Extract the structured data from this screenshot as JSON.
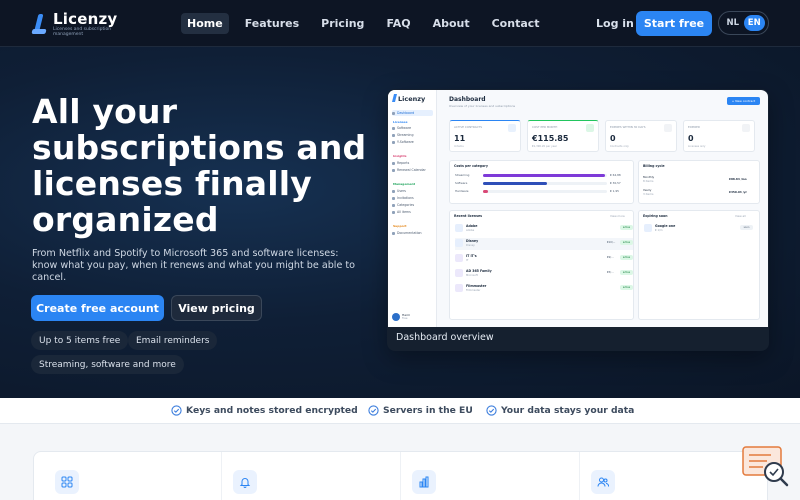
{
  "brand": {
    "name": "Licenzy",
    "tagline": "Licenses and subscription management"
  },
  "nav": {
    "items": [
      "Home",
      "Features",
      "Pricing",
      "FAQ",
      "About",
      "Contact"
    ],
    "active": "Home",
    "login": "Log in",
    "start": "Start free",
    "languages": [
      "NL",
      "EN"
    ],
    "active_language": "EN"
  },
  "hero": {
    "title": "All your subscriptions and licenses finally organized",
    "lead": "From Netflix and Spotify to Microsoft 365 and software licenses: know what you pay, when it renews and what you might be able to cancel.",
    "primary_cta": "Create free account",
    "secondary_cta": "View pricing",
    "chips": [
      "Up to 5 items free",
      "Email reminders",
      "Streaming, software and more"
    ]
  },
  "preview": {
    "caption": "Dashboard overview",
    "app_name": "Licenzy",
    "title": "Dashboard",
    "subtitle": "Overview of your licenses and subscriptions",
    "add_button": "+ New contract",
    "sidebar": {
      "items": [
        {
          "label": "Dashboard",
          "selected": true
        },
        {
          "label": "Licenses",
          "group": true
        },
        {
          "label": "Software"
        },
        {
          "label": "Streaming"
        },
        {
          "label": "Y-Software"
        },
        {
          "label": "Insights",
          "group": true
        },
        {
          "label": "Reports"
        },
        {
          "label": "Renewal Calendar"
        },
        {
          "label": "Management",
          "group": true
        },
        {
          "label": "Users"
        },
        {
          "label": "Invitations"
        },
        {
          "label": "Categories"
        },
        {
          "label": "All items"
        },
        {
          "label": "Support",
          "group": true
        },
        {
          "label": "Documentation"
        }
      ],
      "user_name": "Harm",
      "user_sub": "Free"
    },
    "kpis": [
      {
        "label": "ACTIVE CONTRACTS",
        "value": "11",
        "sub": "4 items"
      },
      {
        "label": "COST PER MONTH",
        "value": "€115.85",
        "sub": "€1,390.20 per year"
      },
      {
        "label": "EXPIRES WITHIN 30 DAYS",
        "value": "0",
        "sub": "Contracts only"
      },
      {
        "label": "EXPIRED",
        "value": "0",
        "sub": "Licenses only"
      }
    ],
    "cost_by_category": {
      "title": "Costs per category",
      "rows": [
        {
          "label": "Streaming",
          "value": "€ 62,88",
          "fraction": 0.98,
          "color": "#7e3ad8"
        },
        {
          "label": "Software",
          "value": "€ 30,57",
          "fraction": 0.52,
          "color": "#2f4fb8"
        },
        {
          "label": "Hardware",
          "value": "€ 1,95",
          "fraction": 0.04,
          "color": "#d94876"
        }
      ]
    },
    "billing_cycle": {
      "title": "Billing cycle",
      "rows": [
        {
          "label": "Monthly",
          "sub": "8 items",
          "value": "€88.84 /mo"
        },
        {
          "label": "Yearly",
          "sub": "3 items",
          "value": "€350.94 /yr"
        }
      ]
    },
    "recent": {
      "title": "Recent licenses",
      "link": "View more",
      "rows": [
        {
          "name": "Adobe",
          "sub": "Adobe",
          "price": "",
          "tag": "active"
        },
        {
          "name": "Disney",
          "sub": "Disney",
          "price": "€10/...",
          "tag": "active"
        },
        {
          "name": "IT IT's",
          "sub": "IT",
          "price": "€9/...",
          "tag": "active"
        },
        {
          "name": "AD 365 Family",
          "sub": "Microsoft",
          "price": "€5/...",
          "tag": "active"
        },
        {
          "name": "Filmmaster",
          "sub": "Filmmaster",
          "price": "",
          "tag": "active"
        }
      ]
    },
    "expiring": {
      "title": "Expiring soon",
      "link": "View all",
      "rows": [
        {
          "name": "Google one",
          "sub": "€ 1/m",
          "tag": "soon"
        }
      ]
    }
  },
  "trust": [
    "Keys and notes stored encrypted",
    "Servers in the EU",
    "Your data stays your data"
  ],
  "feature_icons": [
    "grid-icon",
    "bell-icon",
    "bar-chart-icon",
    "users-icon"
  ],
  "colors": {
    "accent": "#2b85f3",
    "hero_bg": "#0f1f36",
    "header_bg": "#0d1524",
    "check": "#3b7ddd"
  }
}
